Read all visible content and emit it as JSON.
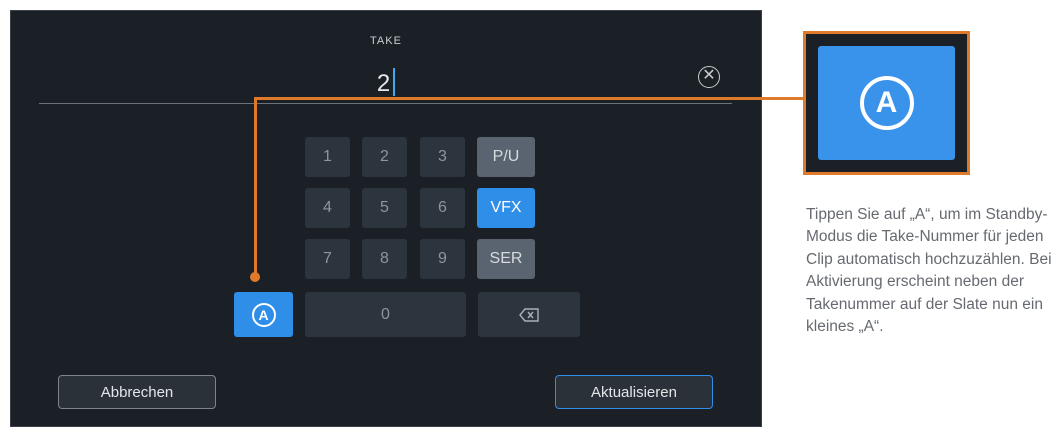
{
  "field": {
    "label": "TAKE",
    "value": "2"
  },
  "icons": {
    "clear": "clear-circle-x-icon",
    "backspace": "backspace-icon",
    "auto_increment": "circled-a-icon"
  },
  "keypad": {
    "rows": [
      [
        "1",
        "2",
        "3",
        "P/U"
      ],
      [
        "4",
        "5",
        "6",
        "VFX"
      ],
      [
        "7",
        "8",
        "9",
        "SER"
      ]
    ],
    "zero": "0",
    "auto_letter": "A",
    "active_key": "VFX"
  },
  "buttons": {
    "cancel": "Abbrechen",
    "update": "Aktualisieren"
  },
  "callout": {
    "letter": "A",
    "caption": "Tippen Sie auf „A“, um im Standby-Modus die Take-Nummer für jeden Clip automatisch hochzuzählen. Bei Aktivierung erscheint neben der Takenummer auf der Slate nun ein kleines „A“."
  },
  "colors": {
    "accent_blue": "#2f8ee8",
    "callout_orange": "#e07a2b",
    "screen_bg": "#1b2026"
  }
}
